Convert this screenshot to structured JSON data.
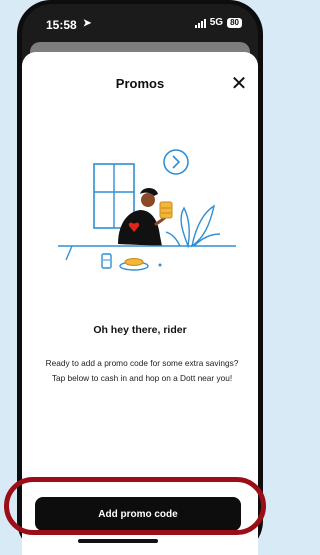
{
  "status_bar": {
    "time": "15:58",
    "location_icon": "location-arrow-icon",
    "network": "5G",
    "battery": "80",
    "signal_icon": "signal-bars-icon"
  },
  "sheet": {
    "title": "Promos",
    "close_icon": "close-icon"
  },
  "illustration": {
    "icon": "rider-at-table-illustration"
  },
  "content": {
    "heading": "Oh hey there, rider",
    "body": "Ready to add a promo code for some extra savings? Tap below to cash in and hop on a Dott near you!"
  },
  "actions": {
    "add_promo_label": "Add promo code"
  },
  "colors": {
    "button_bg": "#0d0d0d",
    "highlight_ring": "#9b0e18",
    "page_bg": "#d9eaf7"
  }
}
